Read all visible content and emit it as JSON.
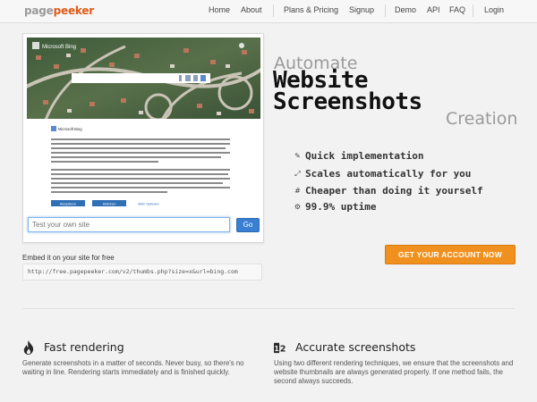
{
  "brand": {
    "part1": "page",
    "part2": "peeker",
    "accent": "#e05a17"
  },
  "nav": {
    "items": [
      "Home",
      "About",
      "Plans & Pricing",
      "Signup",
      "Demo",
      "API",
      "FAQ",
      "Login"
    ]
  },
  "preview": {
    "site": "Microsoft Bing",
    "dialog_brand": "Microsoft Bing",
    "buttons": [
      "Akzeptieren",
      "Ablehnen",
      "Mehr Optionen"
    ]
  },
  "try": {
    "placeholder": "Test your own site",
    "button": "Go"
  },
  "embed": {
    "label": "Embed it on your site for free",
    "code": "http://free.pagepeeker.com/v2/thumbs.php?size=x&url=bing.com"
  },
  "hero": {
    "line1": "Automate",
    "line2": "Website",
    "line3": "Screenshots",
    "line4": "Creation"
  },
  "features": [
    {
      "icon": "pencil-icon",
      "text": "Quick implementation"
    },
    {
      "icon": "resize-icon",
      "text": "Scales automatically for you"
    },
    {
      "icon": "hash-icon",
      "text": "Cheaper than doing it yourself"
    },
    {
      "icon": "gear-icon",
      "text": "99.9% uptime"
    }
  ],
  "cta": {
    "label": "GET YOUR ACCOUNT NOW",
    "color": "#f0911f"
  },
  "bottom": {
    "fast": {
      "icon": "flame-icon",
      "title": "Fast rendering",
      "text": "Generate screenshots in a matter of seconds. Never busy, so there's no waiting in line. Rendering starts immediately and is finished quickly."
    },
    "accurate": {
      "icon": "one-two-icon",
      "title": "Accurate screenshots",
      "text": "Using two different rendering techniques, we ensure that the screenshots and website thumbnails are always generated properly. If one method fails, the second always succeeds."
    }
  }
}
